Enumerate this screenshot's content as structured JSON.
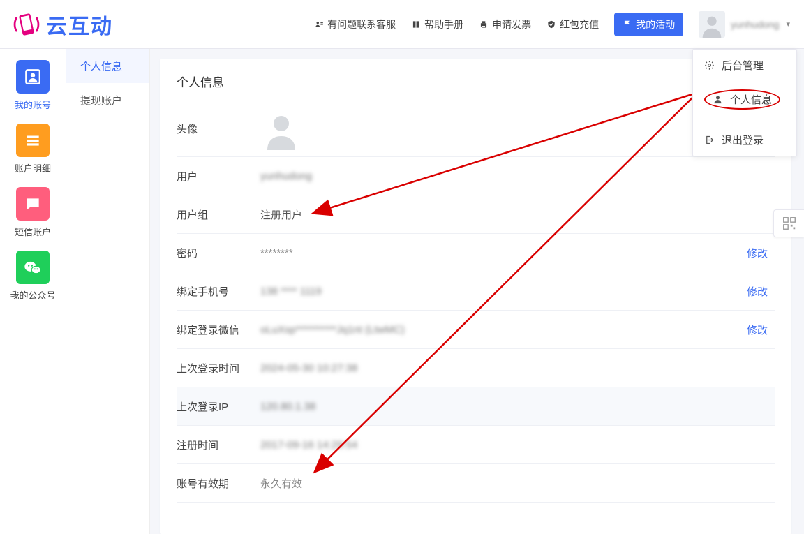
{
  "brand": {
    "text": "云互动"
  },
  "nav": {
    "contact": "有问题联系客服",
    "help": "帮助手册",
    "invoice": "申请发票",
    "recharge": "红包充值",
    "activities": "我的活动",
    "username": "yunhudong"
  },
  "sidebar": {
    "account": "我的账号",
    "detail": "账户明细",
    "sms": "短信账户",
    "wechat": "我的公众号"
  },
  "subnav": {
    "profile": "个人信息",
    "withdraw": "提现账户"
  },
  "dropdown": {
    "admin": "后台管理",
    "profile": "个人信息",
    "logout": "退出登录"
  },
  "panel": {
    "title": "个人信息",
    "rows": {
      "avatar_label": "头像",
      "user_label": "用户",
      "user_value": "yunhudong",
      "group_label": "用户组",
      "group_value": "注册用户",
      "password_label": "密码",
      "password_value": "********",
      "phone_label": "绑定手机号",
      "phone_value": "138 **** 1119",
      "wx_label": "绑定登录微信",
      "wx_value": "oLuXsp**********Jq1nt (LtwMC)",
      "last_login_time_label": "上次登录时间",
      "last_login_time_value": "2024-05-30 10:27:38",
      "last_login_ip_label": "上次登录IP",
      "last_login_ip_value": "120.80.1.38",
      "register_time_label": "注册时间",
      "register_time_value": "2017-09-16 14:29:54",
      "valid_label": "账号有效期",
      "valid_value": "永久有效",
      "modify": "修改"
    }
  }
}
